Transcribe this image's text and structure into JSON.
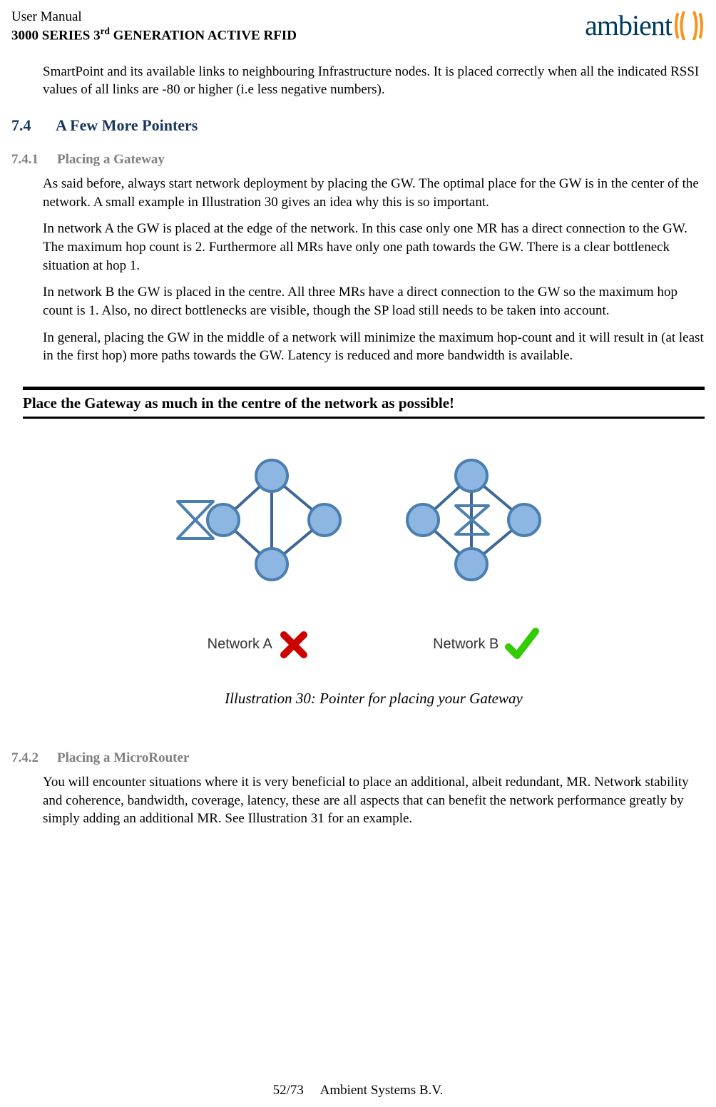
{
  "header": {
    "line1": "User Manual",
    "line2_pre": "3000 SERIES 3",
    "line2_sup": "rd",
    "line2_post": " GENERATION ACTIVE RFID",
    "logo_text": "ambient"
  },
  "intro_para": "SmartPoint and its available links to neighbouring Infrastructure nodes. It is placed correctly when all the indicated RSSI values of all links are -80 or higher (i.e less negative numbers).",
  "sec74": {
    "num": "7.4",
    "title": "A Few More Pointers"
  },
  "sec741": {
    "num": "7.4.1",
    "title": "Placing a Gateway",
    "p1": "As said before, always start network deployment by placing the GW. The optimal place for the GW is in the center of the network. A small example in Illustration 30 gives an idea why this is so important.",
    "p2": "In network A the GW is placed at the edge of the network. In this case only one MR has a direct connection to the GW. The maximum hop count is 2. Furthermore all MRs have only one path towards the GW. There is a clear bottleneck situation at hop 1.",
    "p3": "In network B the GW is placed in the centre. All three MRs have a direct connection to the GW so the maximum hop count is 1. Also, no direct bottlenecks are visible, though the SP load still needs to be taken into account.",
    "p4": "In general, placing the GW in the middle of a network will minimize the maximum hop-count and it will result in (at least in the first hop) more paths towards the GW. Latency is reduced and more bandwidth is available."
  },
  "callout": "Place the Gateway as much in the centre of the network as possible!",
  "diagram": {
    "label_a": "Network A",
    "label_b": "Network B",
    "ill_caption": "Illustration 30: Pointer for placing your Gateway"
  },
  "sec742": {
    "num": "7.4.2",
    "title": "Placing a MicroRouter",
    "p1": "You will encounter situations where it is very beneficial to place an additional, albeit redundant, MR. Network stability and coherence, bandwidth, coverage, latency, these are all aspects that can benefit the network performance greatly by simply adding an additional MR. See Illustration 31 for an example."
  },
  "footer": {
    "page": "52/73",
    "company": "Ambient Systems B.V."
  },
  "colors": {
    "heading_blue": "#17365d",
    "sub_gray": "#7f7f7f",
    "logo_blue": "#003a5e",
    "logo_orange": "#f7941d",
    "node_fill": "#8db7e2",
    "node_stroke": "#4a7fb0",
    "line": "#3d6797",
    "gw_stroke": "#4a7fb0",
    "cross_red": "#cc0000",
    "check_green": "#33cc00"
  }
}
